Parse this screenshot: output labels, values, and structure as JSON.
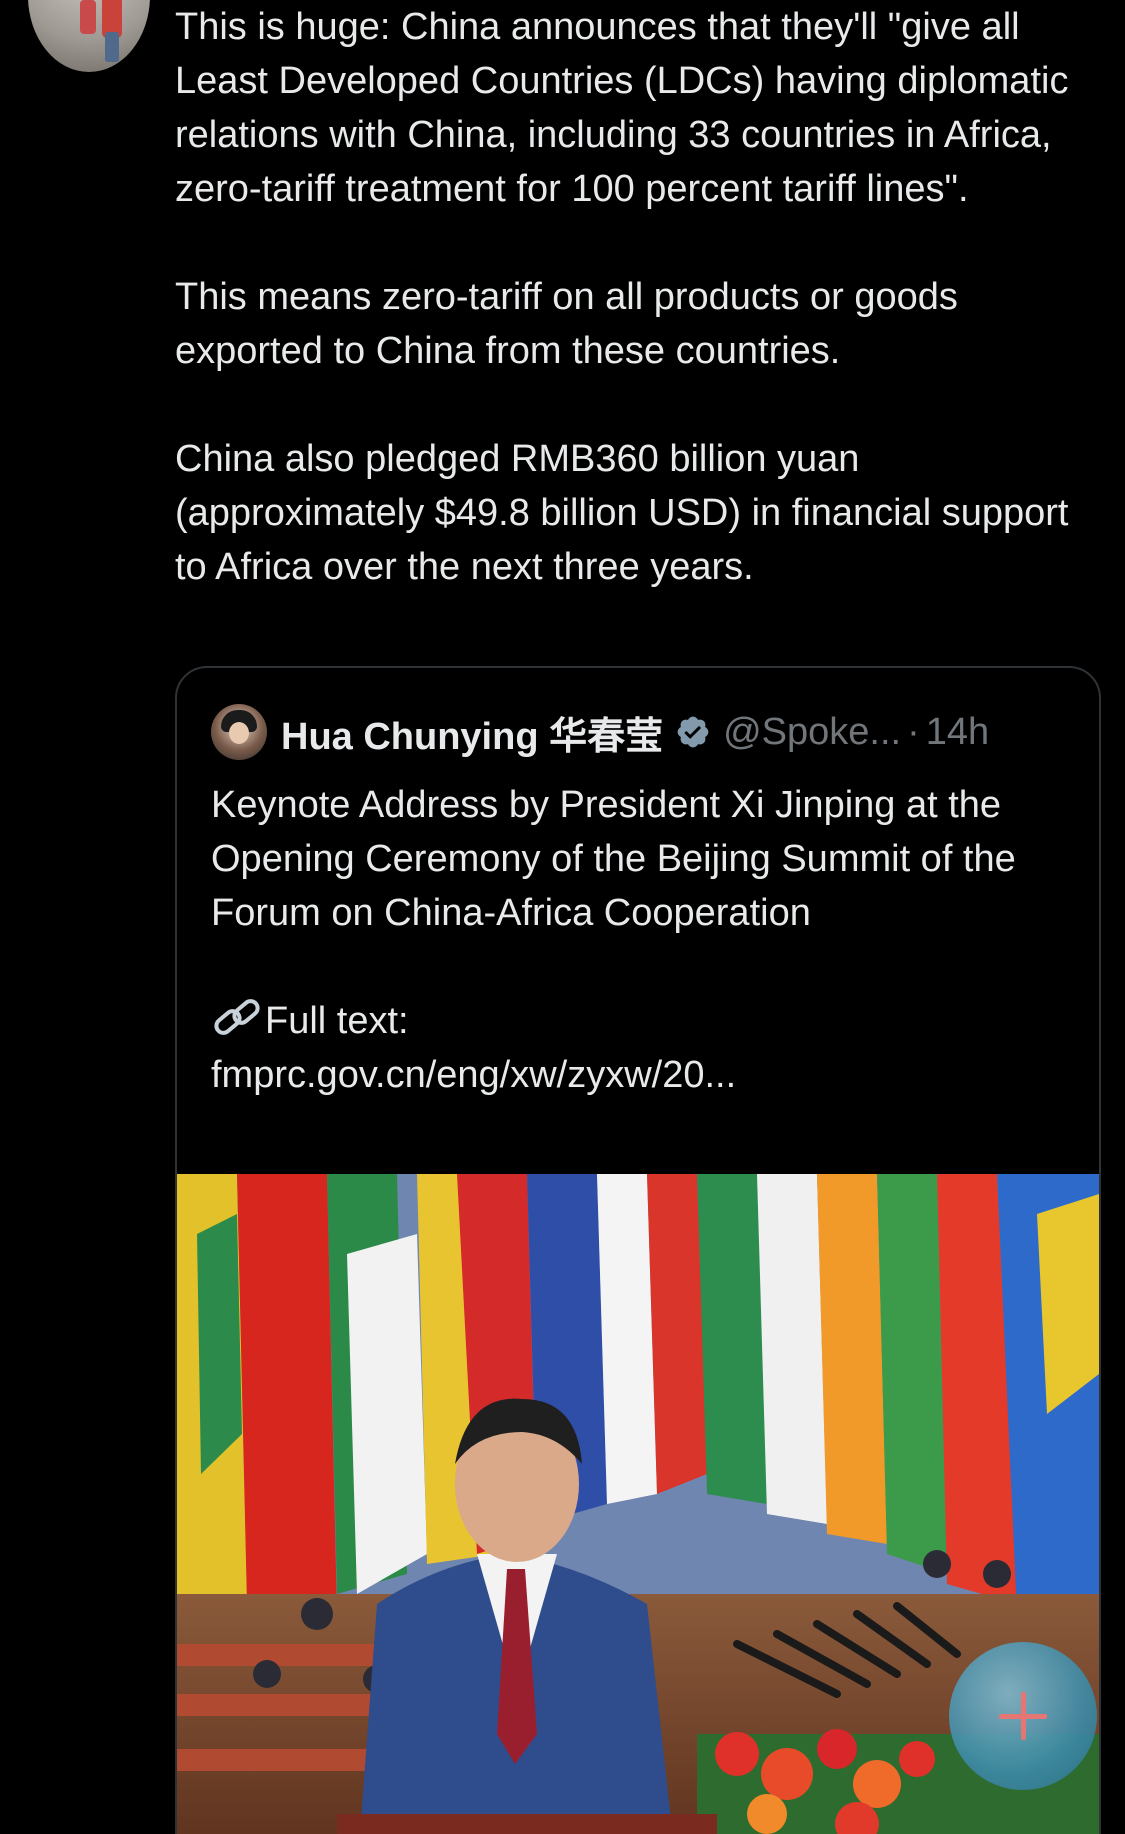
{
  "tweet": {
    "text": "This is huge: China announces that they'll \"give all Least Developed Countries (LDCs) having diplomatic relations with China, including 33 countries in Africa, zero-tariff treatment for 100 percent tariff lines\".\n\nThis means zero-tariff on all products or goods exported to China from these countries.\n\nChina also pledged RMB360 billion yuan (approximately $49.8 billion USD) in financial support to Africa over the next three years."
  },
  "quote": {
    "name": "Hua Chunying 华春莹",
    "handle": "@Spoke...",
    "separator": "·",
    "time": "14h",
    "text_main": "Keynote Address by President Xi Jinping at the Opening Ceremony of the Beijing Summit of the Forum on China-Africa Cooperation\n\n",
    "full_text_label": "Full text:",
    "link": "fmprc.gov.cn/eng/xw/zyxw/20..."
  },
  "colors": {
    "background": "#000000",
    "text": "#e7e9ea",
    "muted": "#71767b",
    "border": "#2f3336",
    "verified": "#829aab"
  },
  "icons": {
    "verified": "verified-badge-icon",
    "link": "link-icon",
    "compose": "plus-icon"
  }
}
